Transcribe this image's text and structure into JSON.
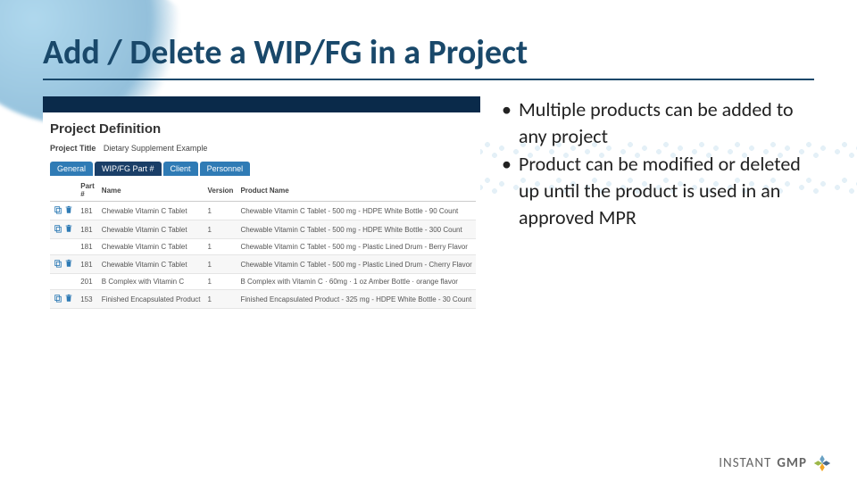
{
  "title": "Add / Delete a WIP/FG in a Project",
  "bullets": [
    "Multiple products can be added to any project",
    "Product can be modified or deleted up until the product is used in an approved MPR"
  ],
  "screenshot": {
    "heading": "Project Definition",
    "subtitle_label": "Project Title",
    "subtitle_value": "Dietary Supplement Example",
    "tabs": [
      "General",
      "WIP/FG Part #",
      "Client",
      "Personnel"
    ],
    "active_tab_index": 1,
    "columns": [
      "",
      "Part #",
      "Name",
      "Version",
      "Product Name"
    ],
    "rows": [
      {
        "copy": true,
        "del": true,
        "part": "181",
        "name": "Chewable Vitamin C Tablet",
        "ver": "1",
        "prod": "Chewable Vitamin C Tablet - 500 mg - HDPE White Bottle - 90 Count"
      },
      {
        "copy": true,
        "del": true,
        "part": "181",
        "name": "Chewable Vitamin C Tablet",
        "ver": "1",
        "prod": "Chewable Vitamin C Tablet - 500 mg - HDPE White Bottle - 300 Count"
      },
      {
        "copy": false,
        "del": false,
        "part": "181",
        "name": "Chewable Vitamin C Tablet",
        "ver": "1",
        "prod": "Chewable Vitamin C Tablet - 500 mg - Plastic Lined Drum - Berry Flavor"
      },
      {
        "copy": true,
        "del": true,
        "part": "181",
        "name": "Chewable Vitamin C Tablet",
        "ver": "1",
        "prod": "Chewable Vitamin C Tablet - 500 mg - Plastic Lined Drum - Cherry Flavor"
      },
      {
        "copy": false,
        "del": false,
        "part": "201",
        "name": "B Complex with Vitamin C",
        "ver": "1",
        "prod": "B Complex with Vitamin C · 60mg · 1 oz Amber Bottle · orange flavor"
      },
      {
        "copy": true,
        "del": true,
        "part": "153",
        "name": "Finished Encapsulated Product",
        "ver": "1",
        "prod": "Finished Encapsulated Product - 325 mg - HDPE White Bottle - 30 Count"
      }
    ]
  },
  "logo": {
    "part1": "INSTANT",
    "part2": "GMP"
  }
}
